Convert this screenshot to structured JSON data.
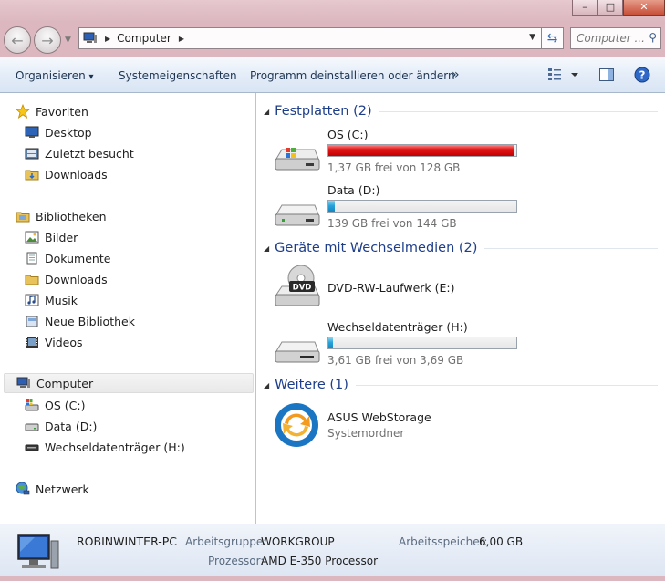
{
  "window": {
    "buttons": {
      "minimize": "–",
      "maximize": "□",
      "close": "✕"
    }
  },
  "address": {
    "path": "Computer",
    "search_placeholder": "Computer ..."
  },
  "toolbar": {
    "organize": "Organisieren",
    "organize_arrow": "▾",
    "properties": "Systemeigenschaften",
    "uninstall": "Programm deinstallieren oder ändern",
    "more": "»"
  },
  "sidebar": {
    "favorites": {
      "label": "Favoriten",
      "items": [
        "Desktop",
        "Zuletzt besucht",
        "Downloads"
      ]
    },
    "libraries": {
      "label": "Bibliotheken",
      "items": [
        "Bilder",
        "Dokumente",
        "Downloads",
        "Musik",
        "Neue Bibliothek",
        "Videos"
      ]
    },
    "computer": {
      "label": "Computer",
      "items": [
        "OS (C:)",
        "Data (D:)",
        "Wechseldatenträger (H:)"
      ]
    },
    "network": {
      "label": "Netzwerk"
    }
  },
  "groups": {
    "hard_disks": {
      "title": "Festplatten (2)",
      "drives": [
        {
          "name": "OS (C:)",
          "free_text": "1,37 GB frei von 128 GB",
          "used_fraction": 0.989
        },
        {
          "name": "Data (D:)",
          "free_text": "139 GB frei von 144 GB",
          "used_fraction": 0.035
        }
      ]
    },
    "removable": {
      "title": "Geräte mit Wechselmedien (2)",
      "dvd": {
        "name": "DVD-RW-Laufwerk (E:)",
        "icon_text": "DVD"
      },
      "usb": {
        "name": "Wechseldatenträger (H:)",
        "free_text": "3,61 GB frei von 3,69 GB",
        "used_fraction": 0.022
      }
    },
    "other": {
      "title": "Weitere (1)",
      "item": {
        "name": "ASUS WebStorage",
        "type": "Systemordner"
      }
    }
  },
  "details": {
    "computer_name": "ROBINWINTER-PC",
    "workgroup_label": "Arbeitsgruppe:",
    "workgroup": "WORKGROUP",
    "memory_label": "Arbeitsspeicher:",
    "memory": "6,00 GB",
    "processor_label": "Prozessor:",
    "processor": "AMD E-350 Processor"
  },
  "colors": {
    "accent_title": "#1e3e8a",
    "drive_full": "#c40000",
    "drive_normal": "#1486c0"
  }
}
